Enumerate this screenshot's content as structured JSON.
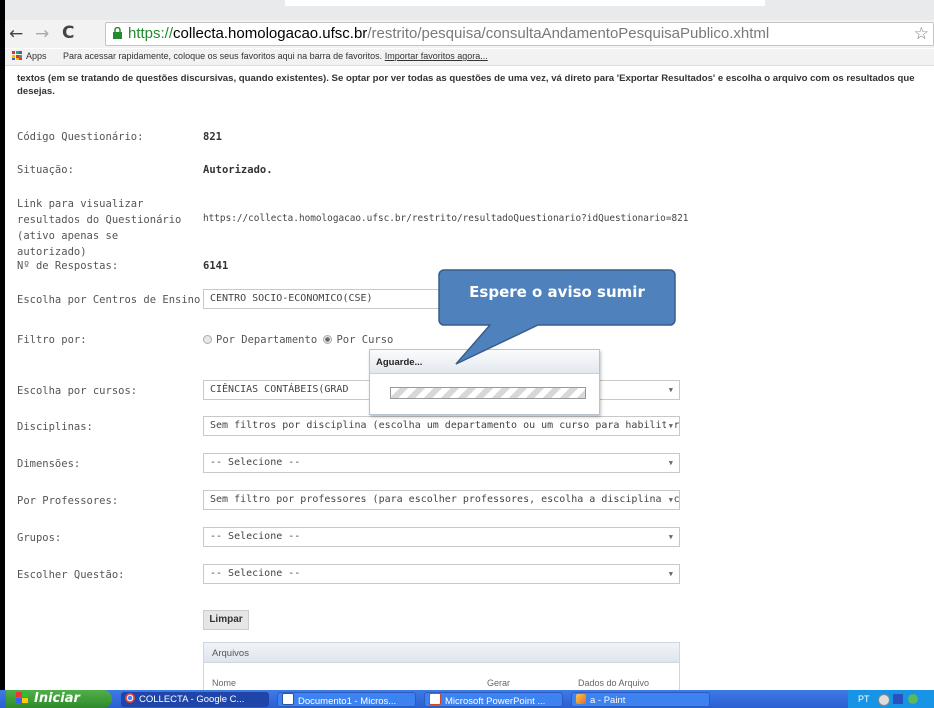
{
  "browser": {
    "address": {
      "scheme": "https://",
      "domain": "collecta.homologacao.ufsc.br",
      "path": "/restrito/pesquisa/consultaAndamentoPesquisaPublico.xhtml"
    },
    "bookmarks_bar": {
      "apps_label": "Apps",
      "message": "Para acessar rapidamente, coloque os seus favoritos aqui na barra de favoritos.",
      "import_link": "Importar favoritos agora..."
    }
  },
  "intro_text": "textos (em se tratando de questões discursivas, quando existentes). Se optar por ver todas as questões de uma vez, vá direto para 'Exportar Resultados' e escolha o arquivo com os resultados que desejas.",
  "form": {
    "codigo_label": "Código Questionário:",
    "codigo_value": "821",
    "situacao_label": "Situação:",
    "situacao_value": "Autorizado.",
    "link_label": "Link para visualizar resultados do Questionário (ativo apenas se autorizado)",
    "link_value": "https://collecta.homologacao.ufsc.br/restrito/resultadoQuestionario?idQuestionario=821",
    "respostas_label": "Nº de Respostas:",
    "respostas_value": "6141",
    "centros_label": "Escolha por Centros de Ensino",
    "centros_value": "CENTRO SOCIO-ECONOMICO(CSE)",
    "filtro_label": "Filtro por:",
    "filtro_option_dept": "Por Departamento",
    "filtro_option_curso": "Por Curso",
    "cursos_label": "Escolha por cursos:",
    "cursos_value": "CIÊNCIAS CONTÁBEIS(GRAD",
    "disciplinas_label": "Disciplinas:",
    "disciplinas_value": "Sem filtros por disciplina (escolha um departamento ou um curso para habilitar es",
    "dimensoes_label": "Dimensões:",
    "dimensoes_value": "-- Selecione --",
    "professores_label": "Por Professores:",
    "professores_value": "Sem filtro por professores (para escolher professores, escolha a disciplina acima r",
    "grupos_label": "Grupos:",
    "grupos_value": "-- Selecione --",
    "questao_label": "Escolher Questão:",
    "questao_value": "-- Selecione --",
    "limpar_label": "Limpar"
  },
  "arquivos": {
    "title": "Arquivos",
    "col_nome": "Nome",
    "col_gerar": "Gerar",
    "col_dados": "Dados do Arquivo"
  },
  "dialog": {
    "title": "Aguarde..."
  },
  "callout": {
    "text": "Espere o aviso sumir",
    "color": "#4f81bd"
  },
  "taskbar": {
    "start_label": "Iniciar",
    "tasks": [
      {
        "label": "COLLECTA - Google C...",
        "icon": "chrome-icon"
      },
      {
        "label": "Documento1 - Micros...",
        "icon": "word-icon"
      },
      {
        "label": "Microsoft PowerPoint ...",
        "icon": "powerpoint-icon"
      },
      {
        "label": "a - Paint",
        "icon": "paint-icon"
      }
    ],
    "tray_lang": "PT"
  }
}
